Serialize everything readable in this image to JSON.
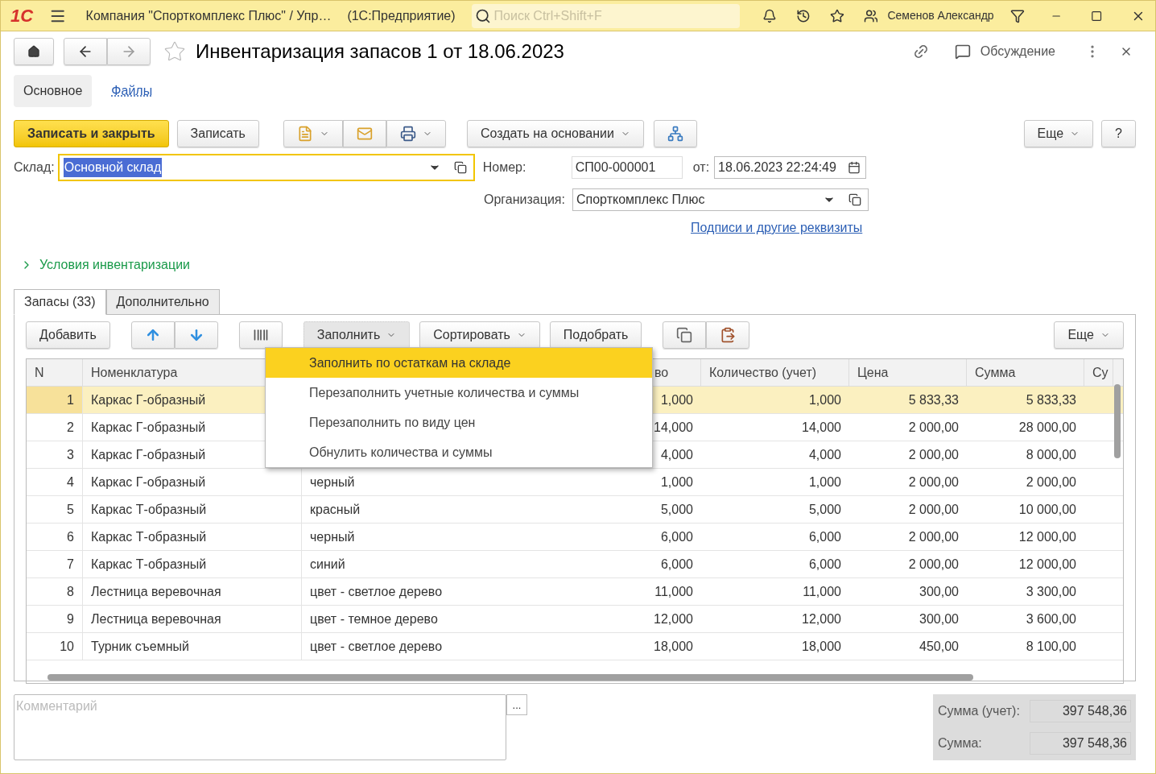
{
  "title_bar": {
    "logo": "1С",
    "title": "Компания \"Спорткомплекс Плюс\" / Упр…",
    "app": "(1С:Предприятие)",
    "search_placeholder": "Поиск Ctrl+Shift+F",
    "user": "Семенов Александр"
  },
  "header": {
    "title": "Инвентаризация запасов 1 от 18.06.2023",
    "favorite": false,
    "discussion": "Обсуждение"
  },
  "form_tabs": [
    {
      "label": "Основное",
      "selected": true
    },
    {
      "label": "Файлы",
      "selected": false
    }
  ],
  "command_bar": {
    "primary": "Записать и закрыть",
    "save": "Записать",
    "create_based": "Создать на основании",
    "more": "Еще",
    "help": "?"
  },
  "fields": {
    "warehouse_label": "Склад:",
    "warehouse": "Основной склад",
    "number_label": "Номер:",
    "number": "СП00-000001",
    "date_label": "от:",
    "date": "18.06.2023 22:24:49",
    "org_label": "Организация:",
    "org": "Спорткомплекс Плюс",
    "link": "Подписи и другие реквизиты"
  },
  "conditions": {
    "label": "Условия инвентаризации",
    "expanded": false
  },
  "table_tabs": [
    {
      "label": "Запасы (33)",
      "selected": true
    },
    {
      "label": "Дополнительно",
      "selected": false
    }
  ],
  "table_bar": {
    "add": "Добавить",
    "fill": "Заполнить",
    "sort": "Сортировать",
    "pick": "Подобрать",
    "more": "Еще"
  },
  "fill_menu": [
    {
      "label": "Заполнить по остаткам на складе",
      "selected": true
    },
    {
      "label": "Перезаполнить учетные количества и суммы",
      "selected": false
    },
    {
      "label": "Перезаполнить по виду цен",
      "selected": false
    },
    {
      "label": "Обнулить количества и суммы",
      "selected": false
    }
  ],
  "table": {
    "columns": [
      "N",
      "Номенклатура",
      "",
      "во",
      "Количество (учет)",
      "Цена",
      "Сумма",
      "Су"
    ],
    "rows": [
      {
        "selected": true,
        "cells": [
          "1",
          "Каркас Г-образный",
          "",
          "1,000",
          "1,000",
          "5 833,33",
          "5 833,33"
        ]
      },
      {
        "selected": false,
        "cells": [
          "2",
          "Каркас Г-образный",
          "",
          "14,000",
          "14,000",
          "2 000,00",
          "28 000,00"
        ]
      },
      {
        "selected": false,
        "cells": [
          "3",
          "Каркас Г-образный",
          "",
          "4,000",
          "4,000",
          "2 000,00",
          "8 000,00"
        ]
      },
      {
        "selected": false,
        "cells": [
          "4",
          "Каркас Г-образный",
          "черный",
          "1,000",
          "1,000",
          "2 000,00",
          "2 000,00"
        ]
      },
      {
        "selected": false,
        "cells": [
          "5",
          "Каркас Т-образный",
          "красный",
          "5,000",
          "5,000",
          "2 000,00",
          "10 000,00"
        ]
      },
      {
        "selected": false,
        "cells": [
          "6",
          "Каркас Т-образный",
          "черный",
          "6,000",
          "6,000",
          "2 000,00",
          "12 000,00"
        ]
      },
      {
        "selected": false,
        "cells": [
          "7",
          "Каркас Т-образный",
          "синий",
          "6,000",
          "6,000",
          "2 000,00",
          "12 000,00"
        ]
      },
      {
        "selected": false,
        "cells": [
          "8",
          "Лестница веревочная",
          "цвет - светлое дерево",
          "11,000",
          "11,000",
          "300,00",
          "3 300,00"
        ]
      },
      {
        "selected": false,
        "cells": [
          "9",
          "Лестница веревочная",
          "цвет - темное дерево",
          "12,000",
          "12,000",
          "300,00",
          "3 600,00"
        ]
      },
      {
        "selected": false,
        "cells": [
          "10",
          "Турник съемный",
          "цвет - светлое дерево",
          "18,000",
          "18,000",
          "450,00",
          "8 100,00"
        ]
      }
    ]
  },
  "footer": {
    "comment_placeholder": "Комментарий",
    "more": "...",
    "totals": [
      {
        "label": "Сумма (учет):",
        "value": "397 548,36"
      },
      {
        "label": "Сумма:",
        "value": "397 548,36"
      }
    ]
  }
}
